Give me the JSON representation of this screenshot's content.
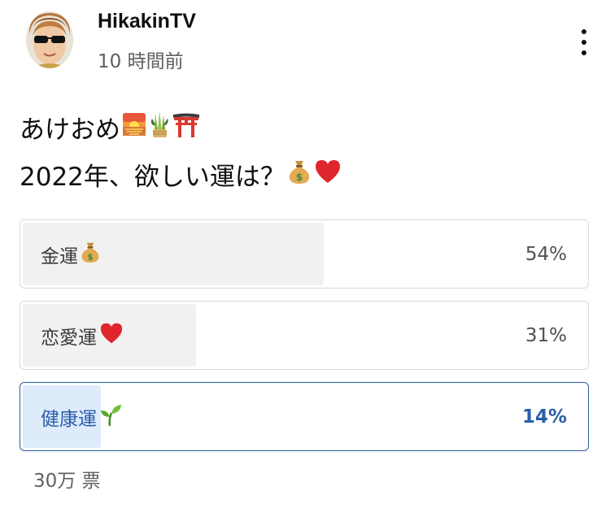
{
  "post": {
    "channel_name": "HikakinTV",
    "time_ago": "10 時間前",
    "text_line1": "あけおめ",
    "text_line2": "2022年、欲しい運は？",
    "line1_icons": [
      "sunrise-icon",
      "kadomatsu-icon",
      "torii-icon"
    ],
    "line2_icons": [
      "money-bag-icon",
      "red-heart-icon"
    ]
  },
  "poll": {
    "options": [
      {
        "label": "金運",
        "percent_text": "54%",
        "fraction": 0.54,
        "icon": "money-bag-icon",
        "selected": false
      },
      {
        "label": "恋愛運",
        "percent_text": "31%",
        "fraction": 0.31,
        "icon": "red-heart-icon",
        "selected": false
      },
      {
        "label": "健康運",
        "percent_text": "14%",
        "fraction": 0.14,
        "icon": "seedling-icon",
        "selected": true
      }
    ],
    "votes": "30万 票"
  },
  "colors": {
    "selected_accent": "#2a5ea8",
    "selected_fill": "#deebfb",
    "unselected_fill": "#f1f1f1",
    "border": "#d9d9d9"
  }
}
